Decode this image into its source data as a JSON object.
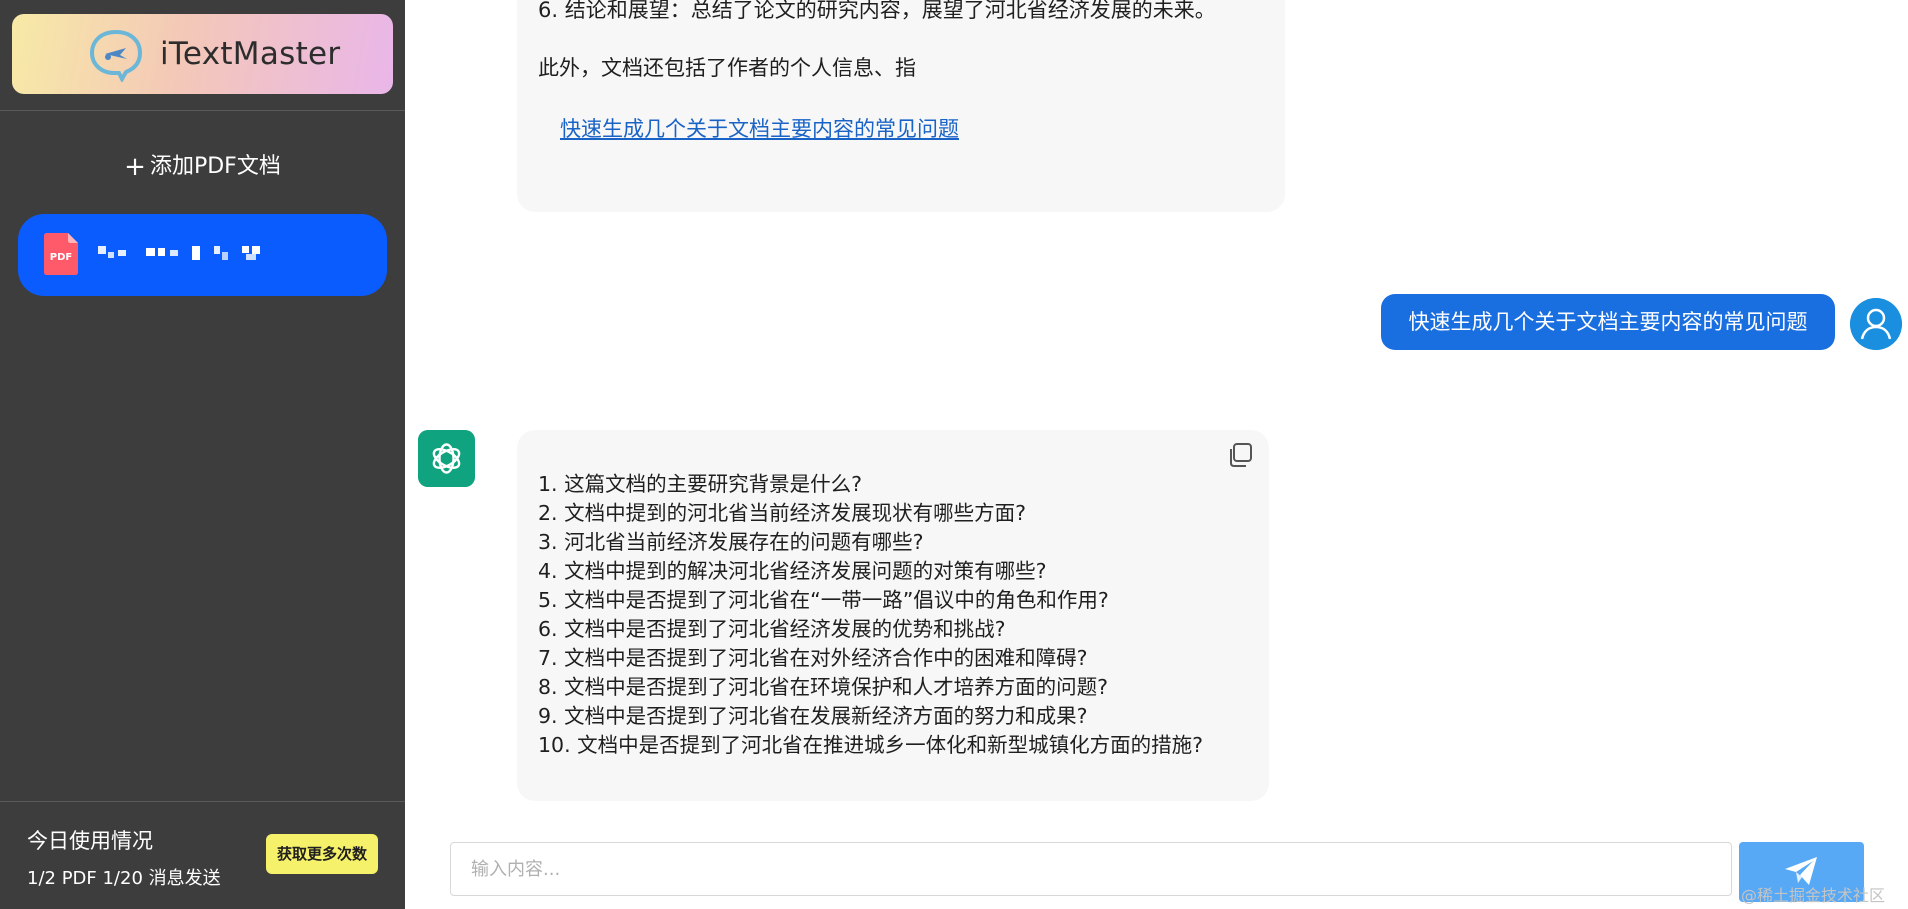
{
  "app": {
    "name": "iTextMaster"
  },
  "sidebar": {
    "add_pdf_label": "添加PDF文档",
    "document_label": "PDF",
    "usage": {
      "title": "今日使用情况",
      "stats": "1/2 PDF  1/20 消息发送",
      "more_button": "获取更多次数"
    }
  },
  "chat": {
    "previous_answer": {
      "line1": "6. 结论和展望：总结了论文的研究内容，展望了河北省经济发展的未来。",
      "line2": "此外，文档还包括了作者的个人信息、指",
      "suggestion_link": "快速生成几个关于文档主要内容的常见问题"
    },
    "user_message": "快速生成几个关于文档主要内容的常见问题",
    "answer_items": [
      "1. 这篇文档的主要研究背景是什么?",
      "2. 文档中提到的河北省当前经济发展现状有哪些方面?",
      "3. 河北省当前经济发展存在的问题有哪些?",
      "4. 文档中提到的解决河北省经济发展问题的对策有哪些?",
      "5. 文档中是否提到了河北省在“一带一路”倡议中的角色和作用?",
      "6. 文档中是否提到了河北省经济发展的优势和挑战?",
      "7. 文档中是否提到了河北省在对外经济合作中的困难和障碍?",
      "8. 文档中是否提到了河北省在环境保护和人才培养方面的问题?",
      "9. 文档中是否提到了河北省在发展新经济方面的努力和成果?",
      "10. 文档中是否提到了河北省在推进城乡一体化和新型城镇化方面的措施?"
    ]
  },
  "input": {
    "placeholder": "输入内容..."
  },
  "watermark": "@稀土掘金技术社区",
  "colors": {
    "sidebar_bg": "#3d3d3d",
    "active_doc": "#0a5cff",
    "user_bubble": "#1a6fe0",
    "bot_avatar": "#10a37f",
    "send_button": "#58a9f5",
    "more_button": "#f6f16a"
  },
  "icons": [
    "logo-icon",
    "plus-icon",
    "pdf-file-icon",
    "user-avatar-icon",
    "openai-logo-icon",
    "copy-icon",
    "send-icon"
  ]
}
